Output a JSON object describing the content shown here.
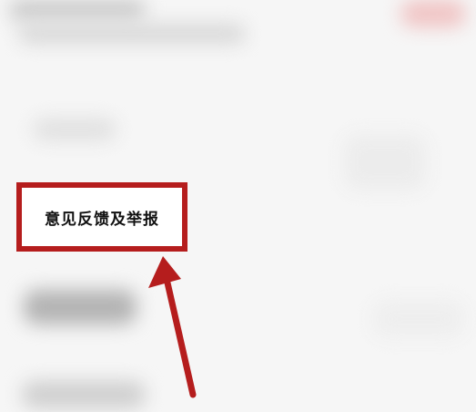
{
  "feedback_item": {
    "label": "意见反馈及举报"
  },
  "annotation": {
    "highlight_color": "#b51d1d",
    "arrow_color": "#b51d1d"
  }
}
